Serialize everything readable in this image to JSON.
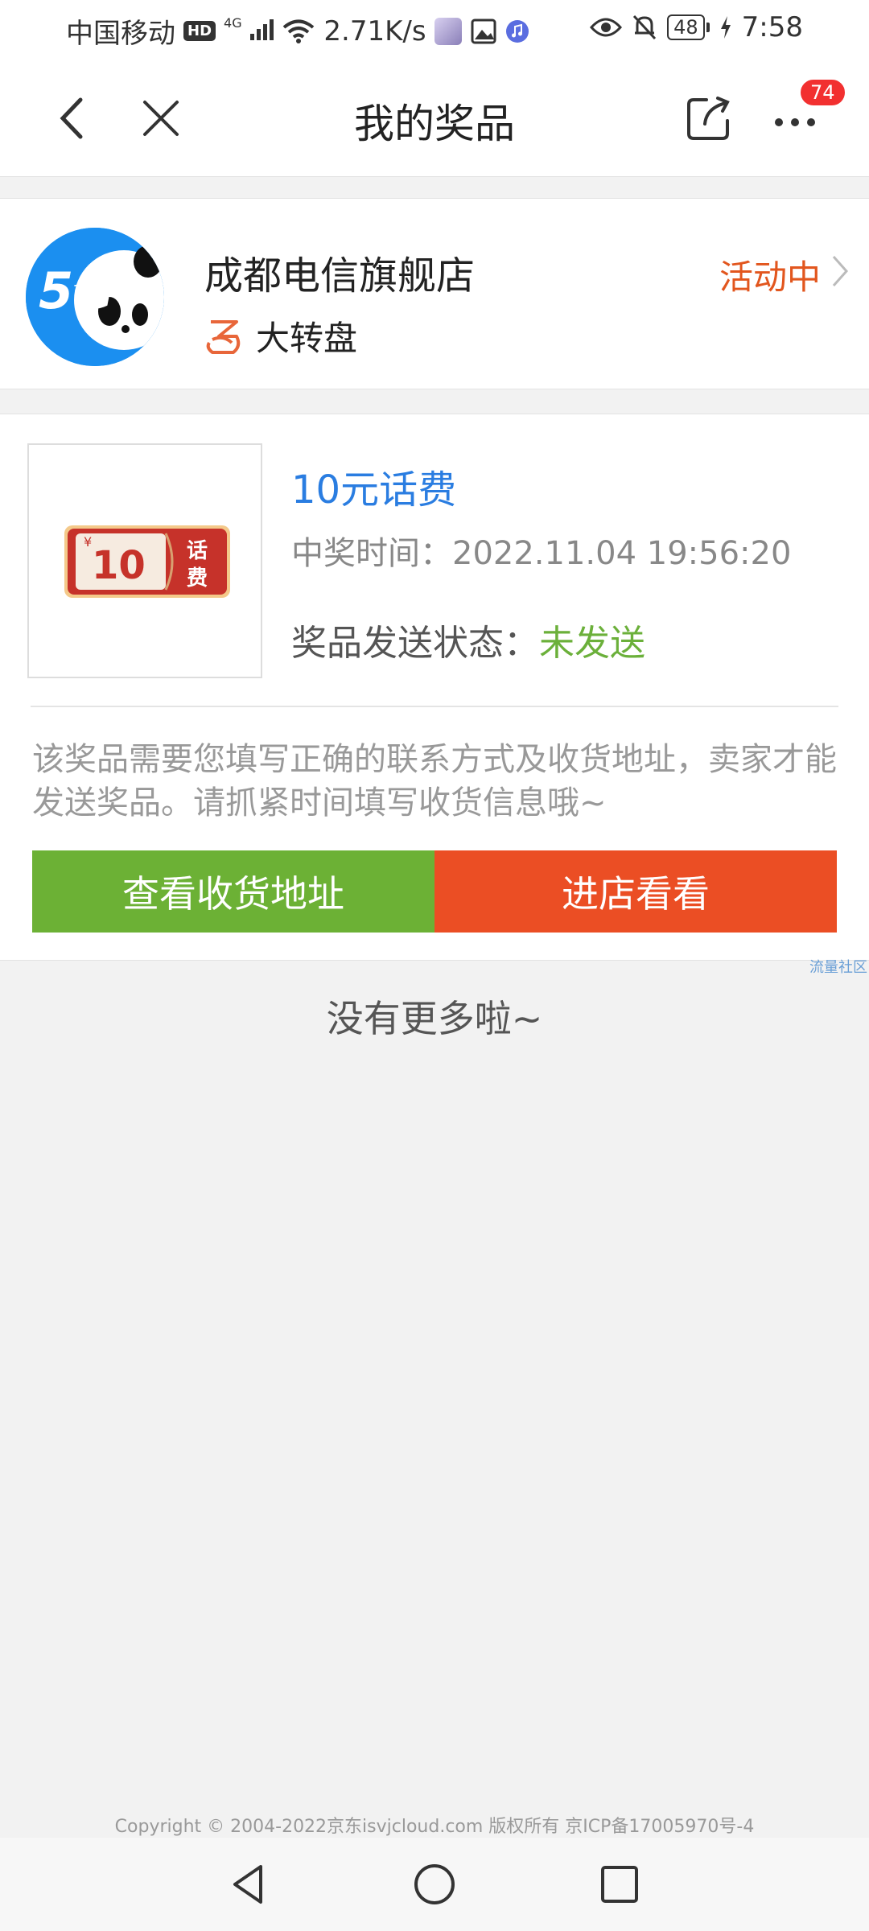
{
  "status_bar": {
    "carrier": "中国移动",
    "hd": "HD",
    "network": "4G",
    "speed": "2.71K/s",
    "battery": "48",
    "time": "7:58"
  },
  "nav": {
    "title": "我的奖品",
    "more_badge": "74"
  },
  "shop": {
    "name": "成都电信旗舰店",
    "status": "活动中",
    "game_label": "大转盘"
  },
  "prize": {
    "name": "10元话费",
    "thumb_value": "10",
    "thumb_label_1": "话",
    "thumb_label_2": "费",
    "time_label": "中奖时间：",
    "time_value": "2022.11.04 19:56:20",
    "status_label": "奖品发送状态：",
    "status_value": "未发送",
    "notice": "该奖品需要您填写正确的联系方式及收货地址，卖家才能发送奖品。请抓紧时间填写收货信息哦~",
    "btn_address": "查看收货地址",
    "btn_shop": "进店看看"
  },
  "watermark": "流量社区",
  "footer": {
    "no_more": "没有更多啦~",
    "copyright": "Copyright © 2004-2022京东isvjcloud.com 版权所有 京ICP备17005970号-4"
  },
  "colors": {
    "accent_blue": "#2a7de1",
    "status_orange": "#e2561e",
    "unsent_green": "#6bb03a",
    "button_green": "#6cb135",
    "button_orange": "#eb4e24"
  }
}
